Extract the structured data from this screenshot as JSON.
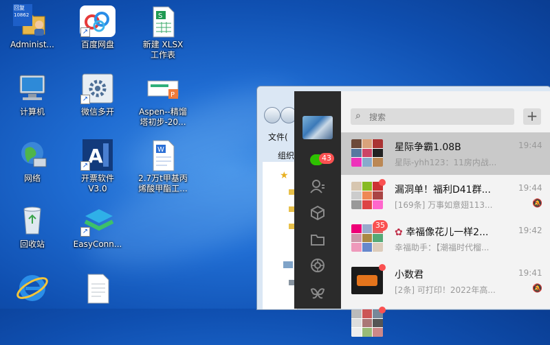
{
  "desktop": {
    "icons": [
      {
        "label": "Administ...",
        "icon": "user-folder-icon"
      },
      {
        "label": "百度网盘",
        "icon": "baidu-netdisk-icon"
      },
      {
        "label": "新建 XLSX",
        "label2": "工作表",
        "icon": "xlsx-file-icon"
      },
      {
        "label": "计算机",
        "icon": "computer-icon"
      },
      {
        "label": "微信多开",
        "icon": "gear-app-icon"
      },
      {
        "label": "Aspen--精馏",
        "label2": "塔初步-20...",
        "icon": "aspen-file-icon"
      },
      {
        "label": "网络",
        "icon": "network-globe-icon"
      },
      {
        "label": "开票软件",
        "label2": "V3.0",
        "icon": "invoice-software-icon"
      },
      {
        "label": "2.7万t甲基丙",
        "label2": "烯酸甲酯工...",
        "icon": "word-file-icon"
      },
      {
        "label": "回收站",
        "icon": "recycle-bin-icon"
      },
      {
        "label": "EasyConn...",
        "icon": "easyconnect-icon"
      },
      {
        "label": "",
        "icon": "internet-explorer-icon"
      },
      {
        "label": "",
        "icon": "text-file-icon"
      }
    ],
    "overlay_text": [
      "回复",
      "10862"
    ]
  },
  "explorer": {
    "menu_file": "文件(",
    "group": "组织"
  },
  "wechat": {
    "search_placeholder": "搜索",
    "plus_label": "+",
    "sidebar_badge": "43",
    "chats": [
      {
        "name": "星际争霸1.08B",
        "preview": "星际-yhh123：11房内战...",
        "time": "19:44",
        "muted": false
      },
      {
        "name": "漏洞单！福利D41群...",
        "preview": "[169条] 万事如意翅113...",
        "time": "19:44",
        "muted": true
      },
      {
        "name": "幸福像花儿一样2...",
        "preview": "幸福助手：【潮福时代榴...",
        "time": "19:42",
        "muted": false,
        "badge": "35"
      },
      {
        "name": "小数君",
        "preview": "[2条] 可打印！2022年高...",
        "time": "19:41",
        "muted": true
      }
    ],
    "colors": {
      "sidebar": "#2b2b2b",
      "badge": "#fa5151",
      "accent": "#2dc100"
    }
  }
}
